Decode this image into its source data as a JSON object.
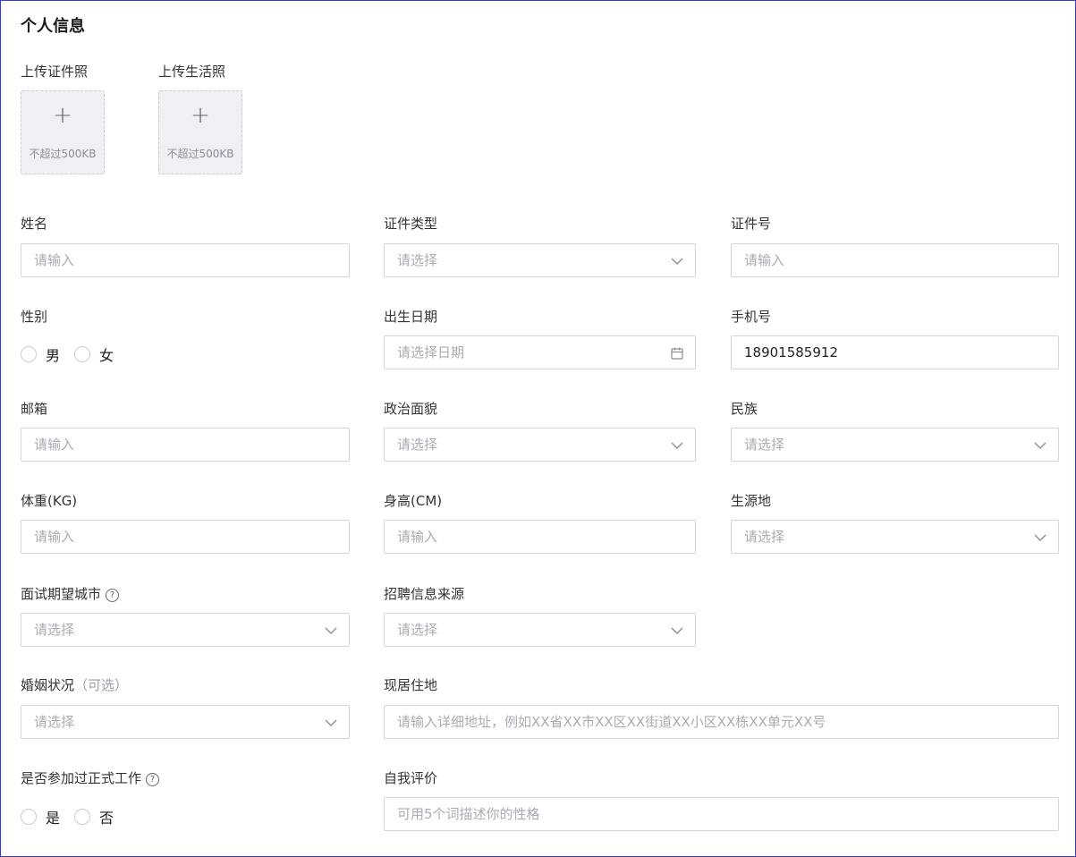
{
  "section_title": "个人信息",
  "uploads": [
    {
      "label": "上传证件照",
      "plus": "+",
      "hint": "不超过500KB"
    },
    {
      "label": "上传生活照",
      "plus": "+",
      "hint": "不超过500KB"
    }
  ],
  "fields": {
    "name": {
      "label": "姓名",
      "placeholder": "请输入"
    },
    "id_type": {
      "label": "证件类型",
      "placeholder": "请选择"
    },
    "id_number": {
      "label": "证件号",
      "placeholder": "请输入"
    },
    "gender": {
      "label": "性别",
      "options": [
        "男",
        "女"
      ]
    },
    "birth_date": {
      "label": "出生日期",
      "placeholder": "请选择日期"
    },
    "phone": {
      "label": "手机号",
      "value": "18901585912"
    },
    "email": {
      "label": "邮箱",
      "placeholder": "请输入"
    },
    "political_status": {
      "label": "政治面貌",
      "placeholder": "请选择"
    },
    "ethnicity": {
      "label": "民族",
      "placeholder": "请选择"
    },
    "weight": {
      "label": "体重(KG)",
      "placeholder": "请输入"
    },
    "height": {
      "label": "身高(CM)",
      "placeholder": "请输入"
    },
    "origin": {
      "label": "生源地",
      "placeholder": "请选择"
    },
    "interview_city": {
      "label": "面试期望城市",
      "placeholder": "请选择",
      "help": "?"
    },
    "recruit_source": {
      "label": "招聘信息来源",
      "placeholder": "请选择"
    },
    "marital_status": {
      "label": "婚姻状况",
      "optional": "（可选）",
      "placeholder": "请选择"
    },
    "address": {
      "label": "现居住地",
      "placeholder": "请输入详细地址，例如XX省XX市XX区XX街道XX小区XX栋XX单元XX号"
    },
    "worked": {
      "label": "是否参加过正式工作",
      "help": "?",
      "options": [
        "是",
        "否"
      ]
    },
    "self_eval": {
      "label": "自我评价",
      "placeholder": "可用5个词描述你的性格"
    }
  },
  "icons": {
    "select_suffix": "chevron-down-icon",
    "date_suffix": "calendar-icon",
    "upload": "plus-icon",
    "help": "question-circle-icon"
  }
}
